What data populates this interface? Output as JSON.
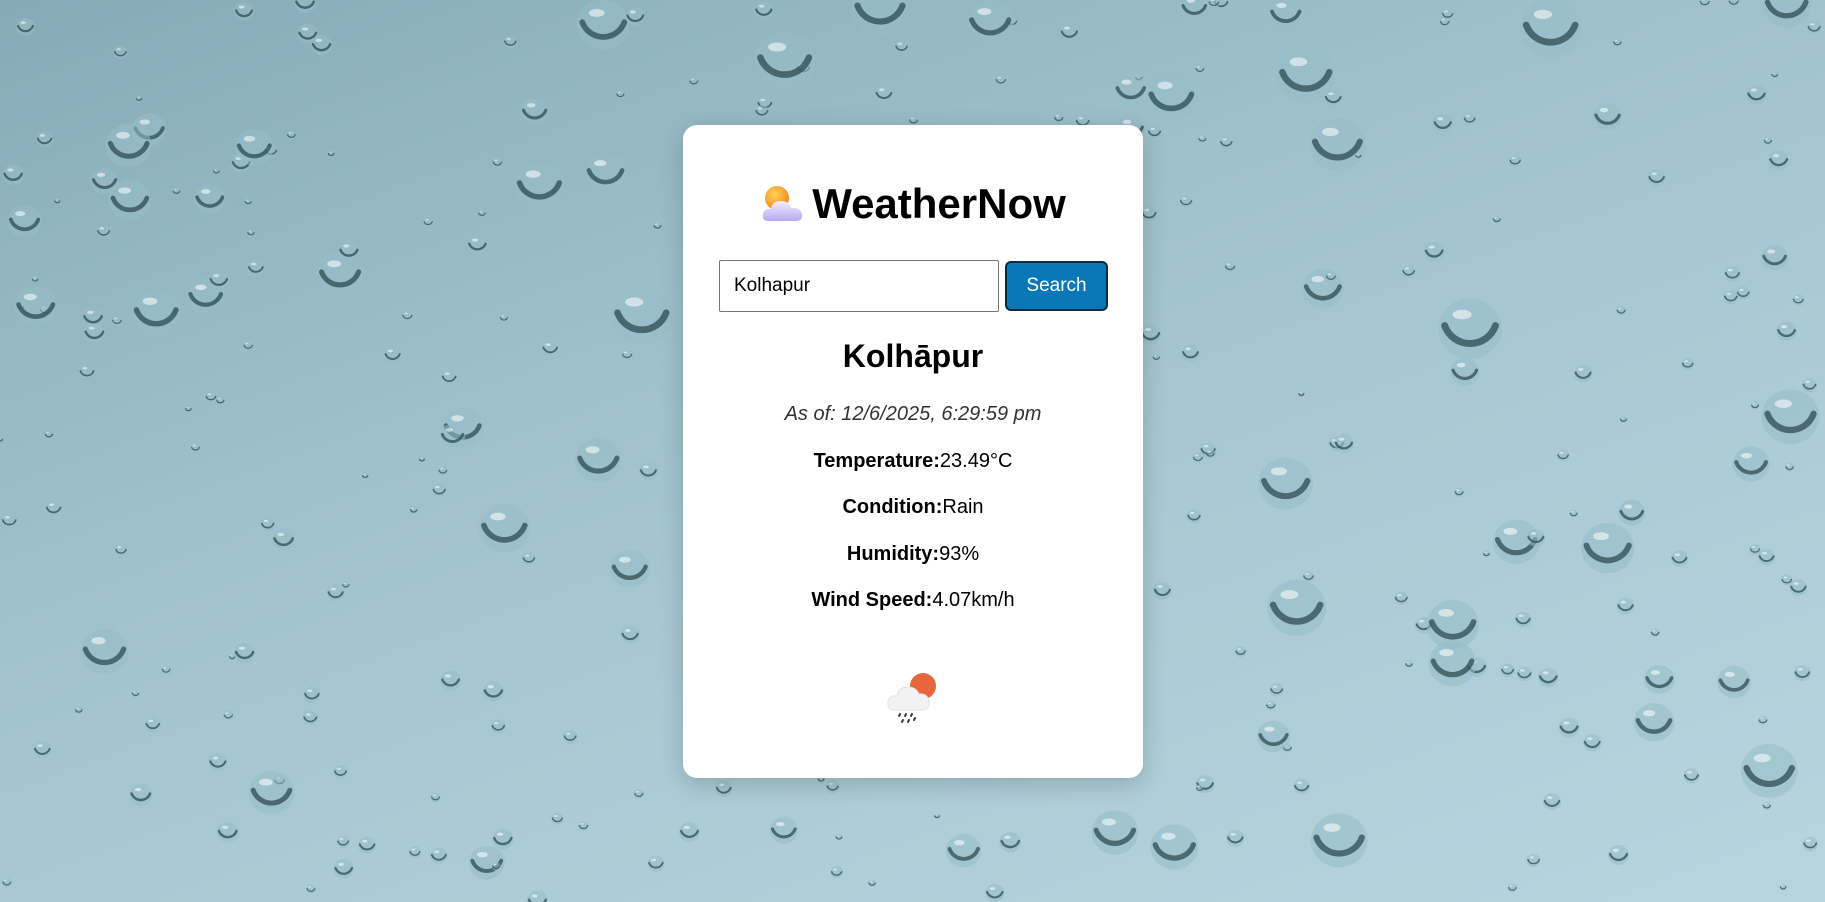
{
  "app": {
    "title": "WeatherNow",
    "logo_icon": "sun-behind-cloud-icon"
  },
  "search": {
    "value": "Kolhapur",
    "placeholder": "",
    "button_label": "Search"
  },
  "weather": {
    "city": "Kolhāpur",
    "as_of": "As of: 12/6/2025, 6:29:59 pm",
    "temperature_label": "Temperature:",
    "temperature_value": "23.49°C",
    "condition_label": "Condition:",
    "condition_value": "Rain",
    "humidity_label": "Humidity:",
    "humidity_value": "93%",
    "wind_label": "Wind Speed:",
    "wind_value": "4.07km/h",
    "condition_icon": "rain-cloud-sun-icon"
  },
  "colors": {
    "background": "#9dbfcb",
    "card": "#ffffff",
    "button": "#0a78b8",
    "button_text": "#ffffff"
  }
}
